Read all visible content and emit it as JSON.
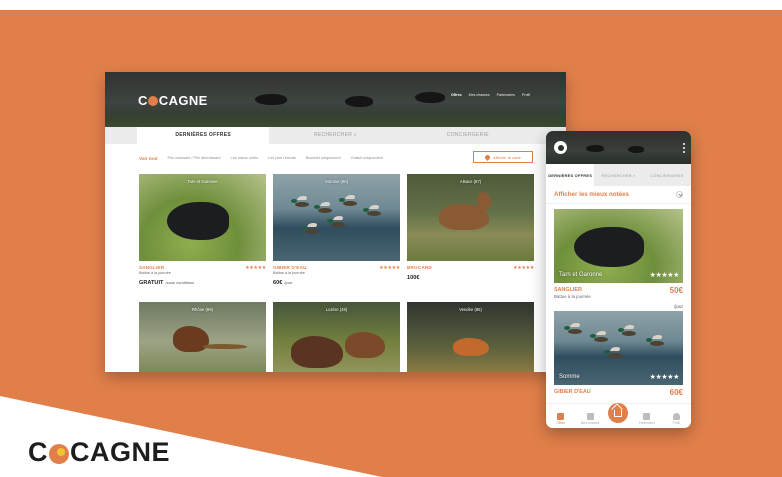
{
  "brand": {
    "name_pre": "C",
    "name_post": "CAGNE"
  },
  "colors": {
    "accent": "#e17f4a",
    "background": "#e17f4a",
    "dark": "#1d1d1d"
  },
  "desktop": {
    "logo_pre": "C",
    "logo_post": "CAGNE",
    "nav": [
      "Offres",
      "Mes chasses",
      "Partenaires",
      "Profil"
    ],
    "tabs": [
      "DERNIÈRES OFFRES",
      "RECHERCHER",
      "CONCIERGERIE"
    ],
    "filters": [
      "Voir tout",
      "Prix croissant / Prix décroissant",
      "Les mieux notés",
      "Les plus récents",
      "Bracelet uniquement",
      "Gratuit uniquement"
    ],
    "map_button": "Afficher la carte",
    "cards": [
      {
        "location": "Tarn et Garonne",
        "species": "SANGLIER",
        "subtitle": "Battue à la journée",
        "stars": "★★★★★",
        "price": "GRATUIT",
        "unit": "/sous conditions"
      },
      {
        "location": "Somme (80)",
        "species": "GIBIER D'EAU",
        "subtitle": "Battue à la journée",
        "stars": "★★★★★",
        "price": "60€",
        "unit": "/jour"
      },
      {
        "location": "Alsace (67)",
        "species": "BROCARD",
        "subtitle": "",
        "stars": "★★★★★",
        "price": "100€",
        "unit": ""
      },
      {
        "location": "Rhône (69)",
        "species": "",
        "subtitle": "",
        "stars": "",
        "price": "",
        "unit": ""
      },
      {
        "location": "Lozère (48)",
        "species": "",
        "subtitle": "",
        "stars": "",
        "price": "",
        "unit": ""
      },
      {
        "location": "Vendée (85)",
        "species": "",
        "subtitle": "",
        "stars": "",
        "price": "",
        "unit": ""
      }
    ]
  },
  "mobile": {
    "tabs": [
      "DERNIÈRES OFFRES",
      "RECHERCHER",
      "CONCIERGERIE"
    ],
    "sort_label": "Afficher les mieux notées",
    "cards": [
      {
        "location": "Tarn et Garonne",
        "stars": "★★★★★",
        "species": "SANGLIER",
        "subtitle": "Battue à la journée",
        "price": "50€",
        "unit": "/jour"
      },
      {
        "location": "Somme",
        "stars": "★★★★★",
        "species": "GIBIER D'EAU",
        "subtitle": "",
        "price": "60€",
        "unit": ""
      }
    ],
    "bottom_nav": [
      "Offres",
      "Mes chasses",
      "Partenaires",
      "Profil"
    ]
  }
}
